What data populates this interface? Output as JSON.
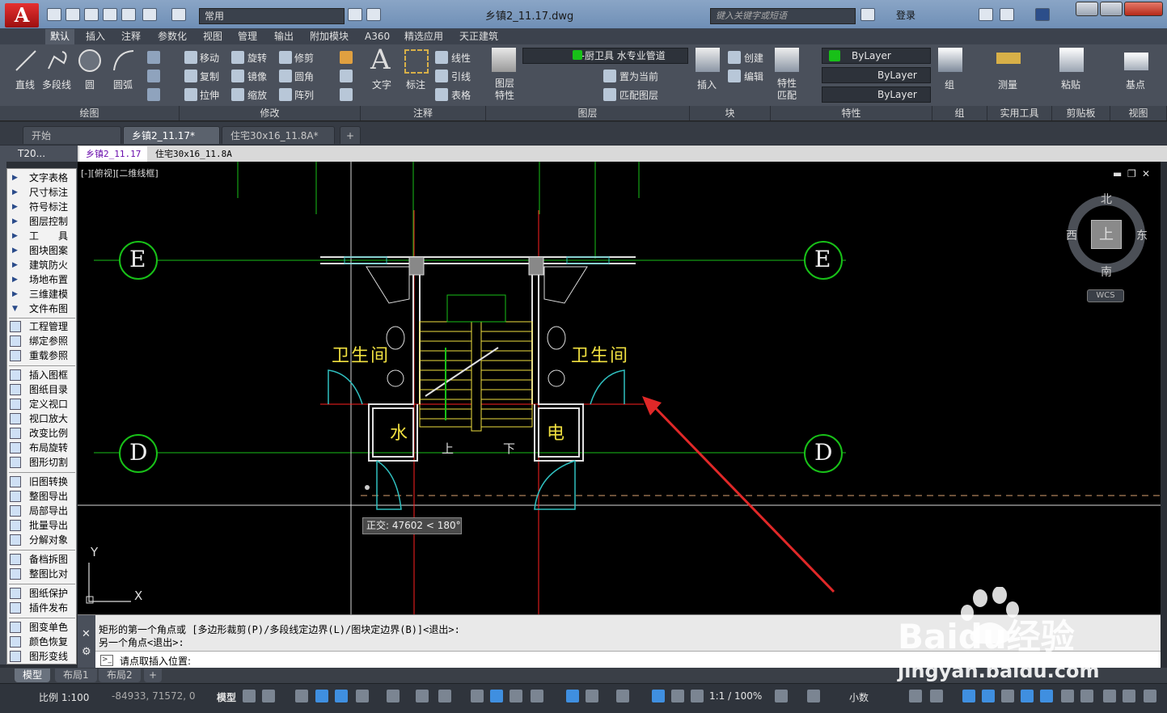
{
  "window": {
    "title": "乡镇2_11.17.dwg",
    "workspace": "常用",
    "search_placeholder": "键入关键字或短语",
    "login": "登录"
  },
  "ribbon_tabs": [
    "默认",
    "插入",
    "注释",
    "参数化",
    "视图",
    "管理",
    "输出",
    "附加模块",
    "A360",
    "精选应用",
    "天正建筑"
  ],
  "ribbon": {
    "draw": {
      "line": "直线",
      "polyline": "多段线",
      "circle": "圆",
      "arc": "圆弧",
      "footer": "绘图"
    },
    "modify": {
      "move": "移动",
      "rotate": "旋转",
      "trim": "修剪",
      "copy": "复制",
      "mirror": "镜像",
      "fillet": "圆角",
      "stretch": "拉伸",
      "scale": "缩放",
      "array": "阵列",
      "footer": "修改"
    },
    "annotation": {
      "text": "文字",
      "dimension": "标注",
      "linetype": "线性",
      "leader": "引线",
      "table": "表格",
      "footer": "注释"
    },
    "layers": {
      "props": "图层特性",
      "current_layer": "0-厨卫具 水专业管道",
      "make_current": "置为当前",
      "match": "匹配图层",
      "footer": "图层"
    },
    "block": {
      "insert": "插入",
      "create": "创建",
      "edit": "编辑",
      "footer": "块"
    },
    "properties": {
      "match": "特性匹配",
      "color": "ByLayer",
      "linetype": "ByLayer",
      "lineweight": "ByLayer",
      "footer": "特性"
    },
    "groups": {
      "group": "组",
      "footer": "组"
    },
    "utilities": {
      "measure": "测量",
      "footer": "实用工具"
    },
    "clipboard": {
      "paste": "粘贴",
      "footer": "剪贴板"
    },
    "view": {
      "base": "基点",
      "footer": "视图"
    }
  },
  "doc_tabs": [
    "开始",
    "乡镇2_11.17*",
    "住宅30x16_11.8A*"
  ],
  "sub_tabs": [
    "乡镇2_11.17",
    "住宅30x16_11.8A"
  ],
  "t20_label": "T20...",
  "palette": {
    "groups": [
      "文字表格",
      "尺寸标注",
      "符号标注",
      "图层控制",
      "工　　具",
      "图块图案",
      "建筑防火",
      "场地布置",
      "三维建模",
      "文件布图"
    ],
    "items": [
      "工程管理",
      "绑定参照",
      "重载参照",
      "插入图框",
      "图纸目录",
      "定义视口",
      "视口放大",
      "改变比例",
      "布局旋转",
      "图形切割",
      "旧图转换",
      "整图导出",
      "局部导出",
      "批量导出",
      "分解对象",
      "备档拆图",
      "整图比对",
      "图纸保护",
      "插件发布",
      "图变单色",
      "颜色恢复",
      "图形变线"
    ]
  },
  "canvas": {
    "view_label": "[-][俯视][二维线框]",
    "axis_labels": {
      "top": "E",
      "bottom": "D"
    },
    "rooms": {
      "bath_left": "卫生间",
      "bath_right": "卫生间",
      "water": "水",
      "electric": "电",
      "up": "上",
      "down": "下"
    },
    "compass": {
      "north": "北",
      "south": "南",
      "east": "东",
      "west": "西",
      "top": "上",
      "wcs": "WCS"
    },
    "tooltip": "正交: 47602 < 180°",
    "ucs": {
      "x": "X",
      "y": "Y"
    }
  },
  "command": {
    "line1": "矩形的第一个角点或 [多边形裁剪(P)/多段线定边界(L)/图块定边界(B)]<退出>:",
    "line2": "另一个角点<退出>:",
    "prompt": "请点取插入位置:"
  },
  "layout_tabs": [
    "模型",
    "布局1",
    "布局2"
  ],
  "status": {
    "scale": "比例 1:100",
    "coords": "-84933, 71572, 0",
    "model": "模型",
    "annot_scale": "1:1 / 100%",
    "units": "小数"
  },
  "watermark": {
    "brand": "Baidu经验",
    "url": "jingyan.baidu.com"
  },
  "colors": {
    "grid": "#18c018",
    "wall": "#e0e0e0",
    "red": "#ff2020",
    "yellow": "#f0e040",
    "cyan": "#30c0c0",
    "arrow": "#e02828"
  }
}
